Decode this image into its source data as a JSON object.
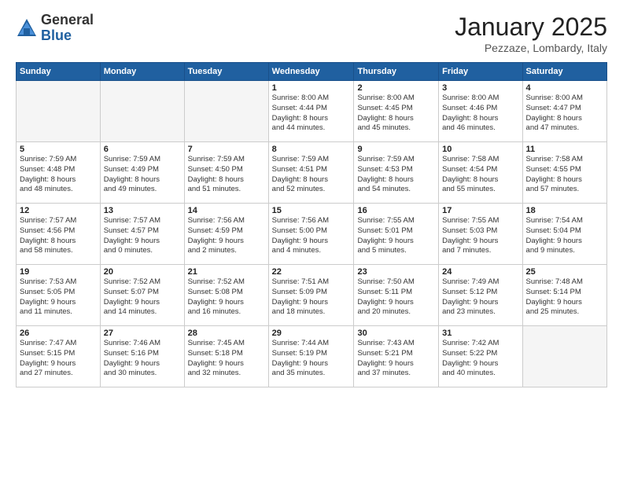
{
  "header": {
    "logo_general": "General",
    "logo_blue": "Blue",
    "month_title": "January 2025",
    "location": "Pezzaze, Lombardy, Italy"
  },
  "weekdays": [
    "Sunday",
    "Monday",
    "Tuesday",
    "Wednesday",
    "Thursday",
    "Friday",
    "Saturday"
  ],
  "weeks": [
    [
      {
        "day": "",
        "info": ""
      },
      {
        "day": "",
        "info": ""
      },
      {
        "day": "",
        "info": ""
      },
      {
        "day": "1",
        "info": "Sunrise: 8:00 AM\nSunset: 4:44 PM\nDaylight: 8 hours\nand 44 minutes."
      },
      {
        "day": "2",
        "info": "Sunrise: 8:00 AM\nSunset: 4:45 PM\nDaylight: 8 hours\nand 45 minutes."
      },
      {
        "day": "3",
        "info": "Sunrise: 8:00 AM\nSunset: 4:46 PM\nDaylight: 8 hours\nand 46 minutes."
      },
      {
        "day": "4",
        "info": "Sunrise: 8:00 AM\nSunset: 4:47 PM\nDaylight: 8 hours\nand 47 minutes."
      }
    ],
    [
      {
        "day": "5",
        "info": "Sunrise: 7:59 AM\nSunset: 4:48 PM\nDaylight: 8 hours\nand 48 minutes."
      },
      {
        "day": "6",
        "info": "Sunrise: 7:59 AM\nSunset: 4:49 PM\nDaylight: 8 hours\nand 49 minutes."
      },
      {
        "day": "7",
        "info": "Sunrise: 7:59 AM\nSunset: 4:50 PM\nDaylight: 8 hours\nand 51 minutes."
      },
      {
        "day": "8",
        "info": "Sunrise: 7:59 AM\nSunset: 4:51 PM\nDaylight: 8 hours\nand 52 minutes."
      },
      {
        "day": "9",
        "info": "Sunrise: 7:59 AM\nSunset: 4:53 PM\nDaylight: 8 hours\nand 54 minutes."
      },
      {
        "day": "10",
        "info": "Sunrise: 7:58 AM\nSunset: 4:54 PM\nDaylight: 8 hours\nand 55 minutes."
      },
      {
        "day": "11",
        "info": "Sunrise: 7:58 AM\nSunset: 4:55 PM\nDaylight: 8 hours\nand 57 minutes."
      }
    ],
    [
      {
        "day": "12",
        "info": "Sunrise: 7:57 AM\nSunset: 4:56 PM\nDaylight: 8 hours\nand 58 minutes."
      },
      {
        "day": "13",
        "info": "Sunrise: 7:57 AM\nSunset: 4:57 PM\nDaylight: 9 hours\nand 0 minutes."
      },
      {
        "day": "14",
        "info": "Sunrise: 7:56 AM\nSunset: 4:59 PM\nDaylight: 9 hours\nand 2 minutes."
      },
      {
        "day": "15",
        "info": "Sunrise: 7:56 AM\nSunset: 5:00 PM\nDaylight: 9 hours\nand 4 minutes."
      },
      {
        "day": "16",
        "info": "Sunrise: 7:55 AM\nSunset: 5:01 PM\nDaylight: 9 hours\nand 5 minutes."
      },
      {
        "day": "17",
        "info": "Sunrise: 7:55 AM\nSunset: 5:03 PM\nDaylight: 9 hours\nand 7 minutes."
      },
      {
        "day": "18",
        "info": "Sunrise: 7:54 AM\nSunset: 5:04 PM\nDaylight: 9 hours\nand 9 minutes."
      }
    ],
    [
      {
        "day": "19",
        "info": "Sunrise: 7:53 AM\nSunset: 5:05 PM\nDaylight: 9 hours\nand 11 minutes."
      },
      {
        "day": "20",
        "info": "Sunrise: 7:52 AM\nSunset: 5:07 PM\nDaylight: 9 hours\nand 14 minutes."
      },
      {
        "day": "21",
        "info": "Sunrise: 7:52 AM\nSunset: 5:08 PM\nDaylight: 9 hours\nand 16 minutes."
      },
      {
        "day": "22",
        "info": "Sunrise: 7:51 AM\nSunset: 5:09 PM\nDaylight: 9 hours\nand 18 minutes."
      },
      {
        "day": "23",
        "info": "Sunrise: 7:50 AM\nSunset: 5:11 PM\nDaylight: 9 hours\nand 20 minutes."
      },
      {
        "day": "24",
        "info": "Sunrise: 7:49 AM\nSunset: 5:12 PM\nDaylight: 9 hours\nand 23 minutes."
      },
      {
        "day": "25",
        "info": "Sunrise: 7:48 AM\nSunset: 5:14 PM\nDaylight: 9 hours\nand 25 minutes."
      }
    ],
    [
      {
        "day": "26",
        "info": "Sunrise: 7:47 AM\nSunset: 5:15 PM\nDaylight: 9 hours\nand 27 minutes."
      },
      {
        "day": "27",
        "info": "Sunrise: 7:46 AM\nSunset: 5:16 PM\nDaylight: 9 hours\nand 30 minutes."
      },
      {
        "day": "28",
        "info": "Sunrise: 7:45 AM\nSunset: 5:18 PM\nDaylight: 9 hours\nand 32 minutes."
      },
      {
        "day": "29",
        "info": "Sunrise: 7:44 AM\nSunset: 5:19 PM\nDaylight: 9 hours\nand 35 minutes."
      },
      {
        "day": "30",
        "info": "Sunrise: 7:43 AM\nSunset: 5:21 PM\nDaylight: 9 hours\nand 37 minutes."
      },
      {
        "day": "31",
        "info": "Sunrise: 7:42 AM\nSunset: 5:22 PM\nDaylight: 9 hours\nand 40 minutes."
      },
      {
        "day": "",
        "info": ""
      }
    ]
  ]
}
